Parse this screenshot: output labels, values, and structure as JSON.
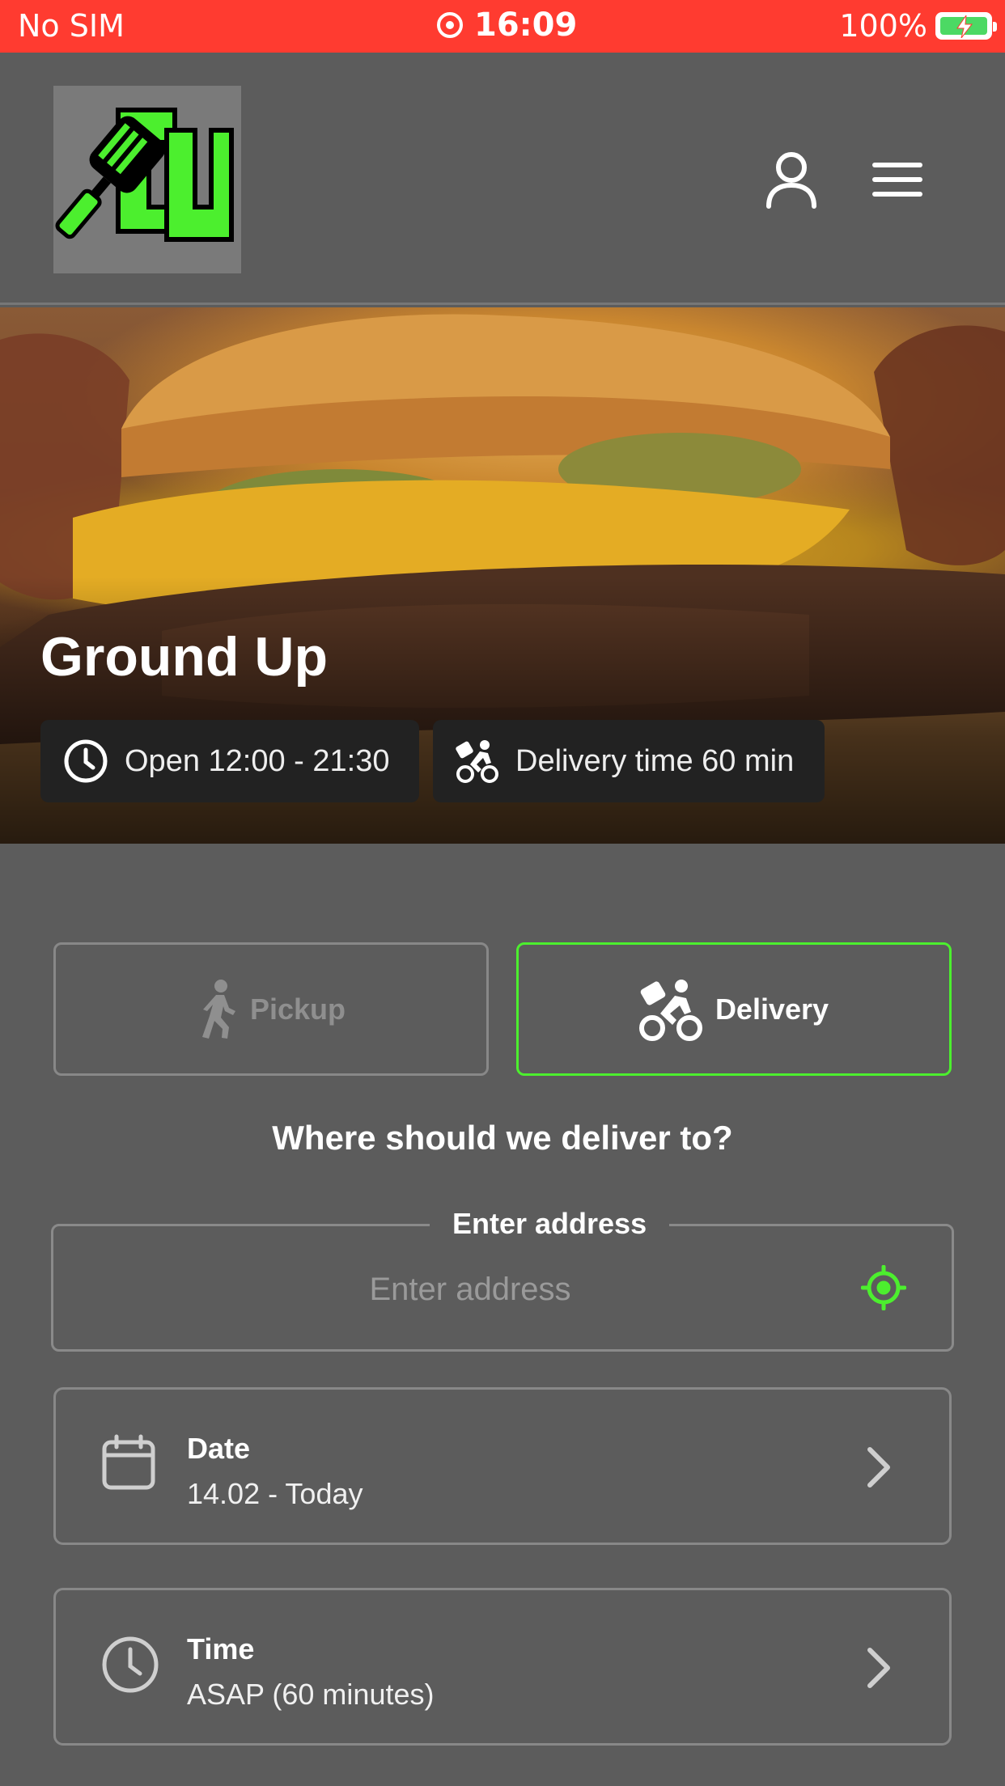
{
  "status_bar": {
    "carrier": "No SIM",
    "time": "16:09",
    "battery": "100%"
  },
  "header": {
    "logo_alt": "Ground Up logo",
    "account_icon": "person-icon",
    "menu_icon": "hamburger-menu-icon"
  },
  "hero": {
    "restaurant_name": "Ground Up",
    "hours_label": "Open 12:00 - 21:30",
    "delivery_time_label": "Delivery time 60 min"
  },
  "order_mode": {
    "pickup_label": "Pickup",
    "delivery_label": "Delivery",
    "selected": "delivery"
  },
  "delivery": {
    "question": "Where should we deliver to?",
    "address_legend": "Enter address",
    "address_placeholder": "Enter address",
    "address_value": ""
  },
  "date_row": {
    "title": "Date",
    "value": "14.02 - Today"
  },
  "time_row": {
    "title": "Time",
    "value": "ASAP (60 minutes)"
  },
  "colors": {
    "status_bar": "#ff3b30",
    "background": "#5c5c5c",
    "accent": "#4cef2e",
    "chip_bg": "#222222"
  }
}
